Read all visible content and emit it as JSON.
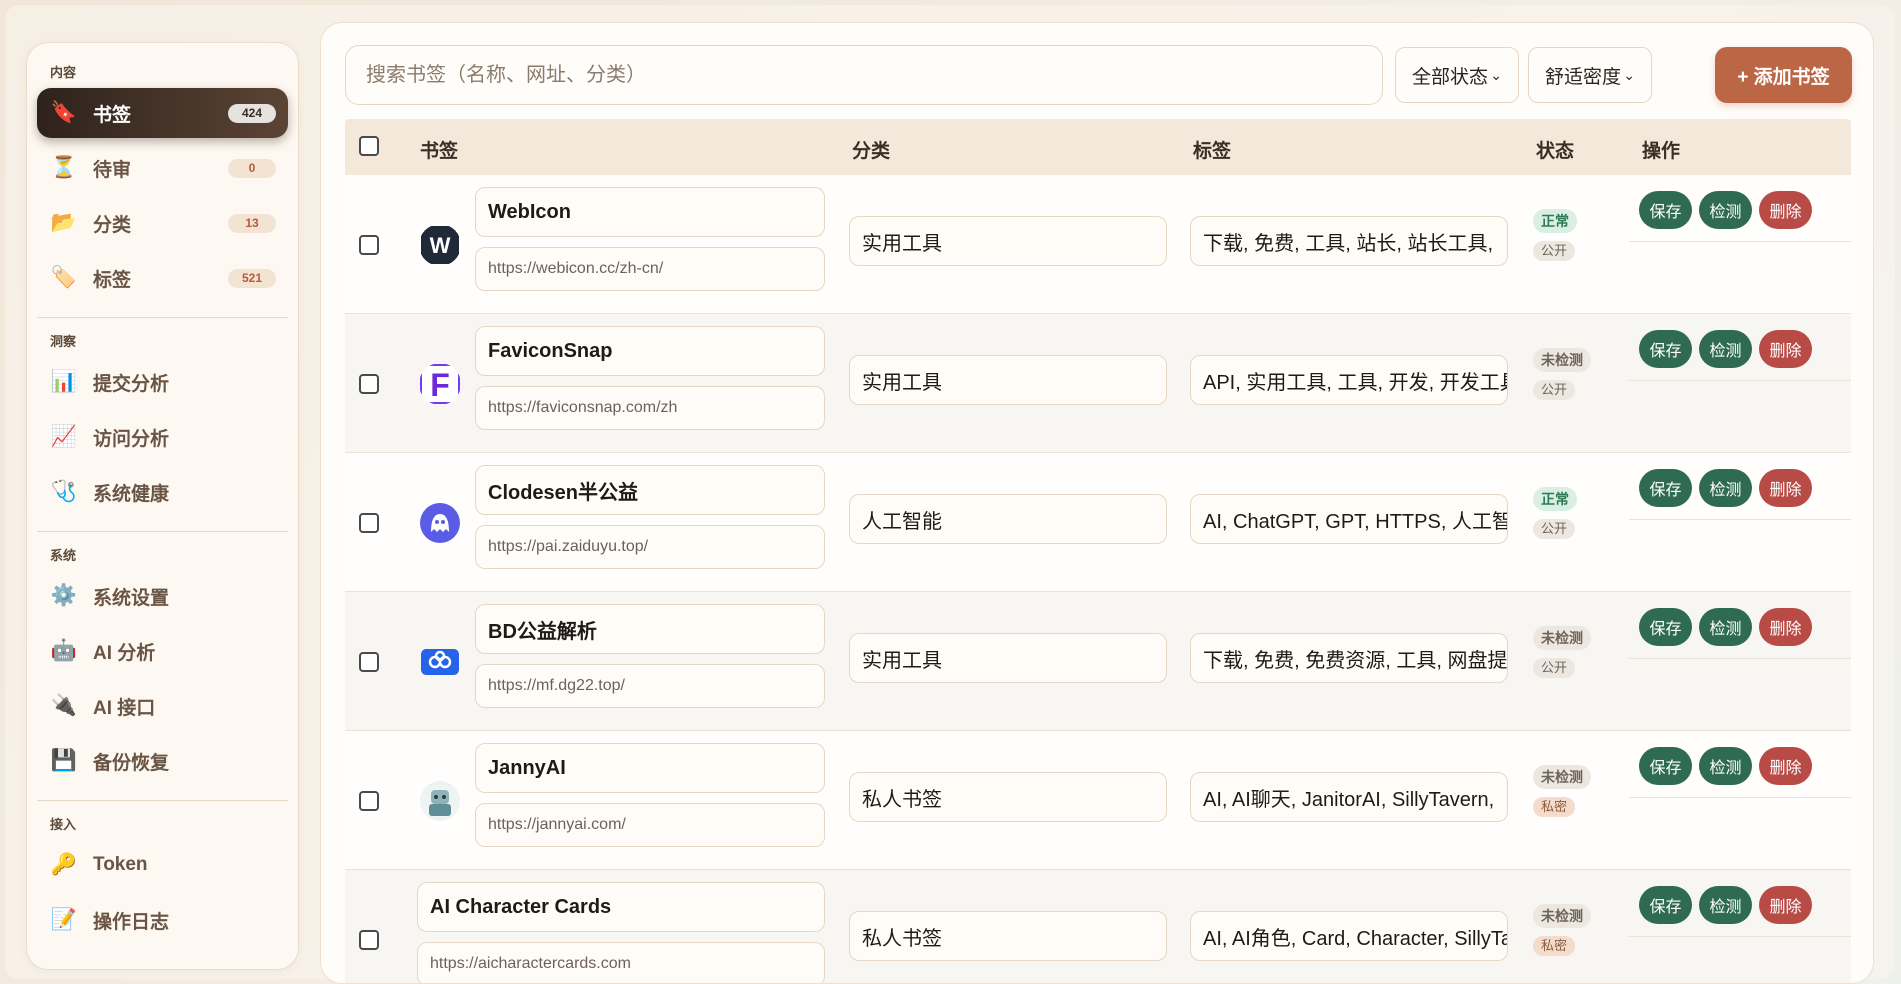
{
  "sidebar": {
    "sections": [
      {
        "title": "内容",
        "items": [
          {
            "label": "书签",
            "count": "424",
            "icon": "bookmark-icon",
            "glyph": "🔖",
            "active": true
          },
          {
            "label": "待审",
            "count": "0",
            "icon": "hourglass-icon",
            "glyph": "⏳"
          },
          {
            "label": "分类",
            "count": "13",
            "icon": "folder-icon",
            "glyph": "📂"
          },
          {
            "label": "标签",
            "count": "521",
            "icon": "tag-icon",
            "glyph": "🏷️"
          }
        ]
      },
      {
        "title": "洞察",
        "items": [
          {
            "label": "提交分析",
            "icon": "bar-chart-icon",
            "glyph": "📊"
          },
          {
            "label": "访问分析",
            "icon": "line-chart-icon",
            "glyph": "📈"
          },
          {
            "label": "系统健康",
            "icon": "stethoscope-icon",
            "glyph": "🩺"
          }
        ]
      },
      {
        "title": "系统",
        "items": [
          {
            "label": "系统设置",
            "icon": "gear-icon",
            "glyph": "⚙️"
          },
          {
            "label": "AI 分析",
            "icon": "robot-icon",
            "glyph": "🤖"
          },
          {
            "label": "AI 接口",
            "icon": "plug-icon",
            "glyph": "🔌"
          },
          {
            "label": "备份恢复",
            "icon": "floppy-disk-icon",
            "glyph": "💾"
          }
        ]
      },
      {
        "title": "接入",
        "items": [
          {
            "label": "Token",
            "icon": "key-icon",
            "glyph": "🔑"
          },
          {
            "label": "操作日志",
            "icon": "memo-icon",
            "glyph": "📝"
          }
        ]
      }
    ]
  },
  "toolbar": {
    "search_placeholder": "搜索书签（名称、网址、分类）",
    "status_filter": "全部状态",
    "density": "舒适密度",
    "add_label": "+ 添加书签"
  },
  "table": {
    "headers": {
      "bookmark": "书签",
      "category": "分类",
      "tags": "标签",
      "status": "状态",
      "actions": "操作"
    },
    "actions": {
      "save": "保存",
      "check": "检测",
      "delete": "删除"
    },
    "rows": [
      {
        "name": "WebIcon",
        "url": "https://webicon.cc/zh-cn/",
        "category": "实用工具",
        "tags": "下载, 免费, 工具, 站长, 站长工具, ",
        "status": "正常",
        "status_kind": "ok",
        "visibility": "公开",
        "favicon": "webicon",
        "favicon_icon": "webicon-logo-icon"
      },
      {
        "name": "FaviconSnap",
        "url": "https://faviconsnap.com/zh",
        "category": "实用工具",
        "tags": "API, 实用工具, 工具, 开发, 开发工具",
        "status": "未检测",
        "status_kind": "un",
        "visibility": "公开",
        "favicon": "faviconsnap",
        "favicon_icon": "faviconsnap-logo-icon"
      },
      {
        "name": "Clodesen半公益",
        "url": "https://pai.zaiduyu.top/",
        "category": "人工智能",
        "tags": "AI, ChatGPT, GPT, HTTPS, 人工智能",
        "status": "正常",
        "status_kind": "ok",
        "visibility": "公开",
        "favicon": "clodesen",
        "favicon_icon": "ghost-logo-icon"
      },
      {
        "name": "BD公益解析",
        "url": "https://mf.dg22.top/",
        "category": "实用工具",
        "tags": "下载, 免费, 免费资源, 工具, 网盘提取",
        "status": "未检测",
        "status_kind": "un",
        "visibility": "公开",
        "favicon": "bd",
        "favicon_icon": "baidu-cloud-logo-icon"
      },
      {
        "name": "JannyAI",
        "url": "https://jannyai.com/",
        "category": "私人书签",
        "tags": "AI, AI聊天, JanitorAI, SillyTavern, ",
        "status": "未检测",
        "status_kind": "un",
        "visibility": "私密",
        "favicon": "janny",
        "favicon_icon": "janny-logo-icon"
      },
      {
        "name": "AI Character Cards",
        "url": "https://aicharactercards.com",
        "category": "私人书签",
        "tags": "AI, AI角色, Card, Character, SillyTavern",
        "status": "未检测",
        "status_kind": "un",
        "visibility": "私密",
        "favicon": "none",
        "favicon_icon": ""
      }
    ]
  },
  "colors": {
    "accent": "#bb6746",
    "save": "#2f6b53",
    "delete": "#b84b45"
  }
}
